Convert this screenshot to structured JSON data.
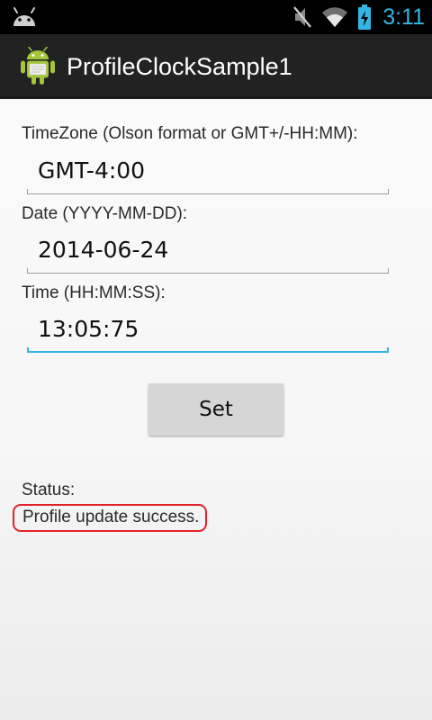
{
  "status_bar": {
    "time": "3:11",
    "icons": [
      "android-notification-icon",
      "mute-icon",
      "wifi-icon",
      "battery-charging-icon"
    ],
    "time_color": "#33b5e5"
  },
  "action_bar": {
    "title": "ProfileClockSample1",
    "icon": "android-app-icon"
  },
  "form": {
    "timezone": {
      "label": "TimeZone (Olson format or GMT+/-HH:MM):",
      "value": "GMT-4:00"
    },
    "date": {
      "label": "Date (YYYY-MM-DD):",
      "value": "2014-06-24"
    },
    "time": {
      "label": "Time (HH:MM:SS):",
      "value": "13:05:75"
    },
    "set_label": "Set"
  },
  "status": {
    "label": "Status:",
    "message": "Profile update success."
  },
  "colors": {
    "accent": "#33b5e5",
    "highlight": "#e2222a",
    "action_bar": "#222222"
  }
}
